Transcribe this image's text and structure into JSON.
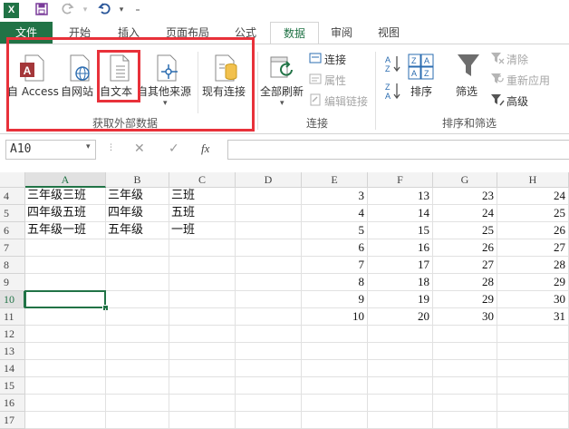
{
  "titlebar": {
    "logo": "X",
    "save_icon": "save-icon",
    "redo_icon": "redo-icon",
    "undo_icon": "undo-icon",
    "customize_icon": "customize-qat-icon"
  },
  "tabs": [
    "文件",
    "开始",
    "插入",
    "页面布局",
    "公式",
    "数据",
    "审阅",
    "视图"
  ],
  "ribbon": {
    "get_external": {
      "buttons": [
        "自 Access",
        "自网站",
        "自文本",
        "自其他来源",
        "现有连接"
      ],
      "group_label": "获取外部数据"
    },
    "connections": {
      "refresh_all": "全部刷新",
      "items": [
        "连接",
        "属性",
        "编辑链接"
      ],
      "group_label": "连接"
    },
    "sort_filter": {
      "sort": "排序",
      "filter": "筛选",
      "items": [
        "清除",
        "重新应用",
        "高级"
      ],
      "group_label": "排序和筛选"
    }
  },
  "formula_bar": {
    "name_box": "A10",
    "cancel": "✕",
    "enter": "✓",
    "fx": "fx",
    "value": ""
  },
  "grid": {
    "columns": [
      "A",
      "B",
      "C",
      "D",
      "E",
      "F",
      "G",
      "H"
    ],
    "active_column": "A",
    "active_row": "10",
    "rows": [
      {
        "num": "4",
        "cells": [
          "三年级三班",
          "三年级",
          "三班",
          "",
          "3",
          "13",
          "23",
          "24"
        ]
      },
      {
        "num": "5",
        "cells": [
          "四年级五班",
          "四年级",
          "五班",
          "",
          "4",
          "14",
          "24",
          "25"
        ]
      },
      {
        "num": "6",
        "cells": [
          "五年级一班",
          "五年级",
          "一班",
          "",
          "5",
          "15",
          "25",
          "26"
        ]
      },
      {
        "num": "7",
        "cells": [
          "",
          "",
          "",
          "",
          "6",
          "16",
          "26",
          "27"
        ]
      },
      {
        "num": "8",
        "cells": [
          "",
          "",
          "",
          "",
          "7",
          "17",
          "27",
          "28"
        ]
      },
      {
        "num": "9",
        "cells": [
          "",
          "",
          "",
          "",
          "8",
          "18",
          "28",
          "29"
        ]
      },
      {
        "num": "10",
        "cells": [
          "",
          "",
          "",
          "",
          "9",
          "19",
          "29",
          "30"
        ]
      },
      {
        "num": "11",
        "cells": [
          "",
          "",
          "",
          "",
          "10",
          "20",
          "30",
          "31"
        ]
      },
      {
        "num": "12",
        "cells": [
          "",
          "",
          "",
          "",
          "",
          "",
          "",
          ""
        ]
      },
      {
        "num": "13",
        "cells": [
          "",
          "",
          "",
          "",
          "",
          "",
          "",
          ""
        ]
      },
      {
        "num": "14",
        "cells": [
          "",
          "",
          "",
          "",
          "",
          "",
          "",
          ""
        ]
      },
      {
        "num": "15",
        "cells": [
          "",
          "",
          "",
          "",
          "",
          "",
          "",
          ""
        ]
      },
      {
        "num": "16",
        "cells": [
          "",
          "",
          "",
          "",
          "",
          "",
          "",
          ""
        ]
      },
      {
        "num": "17",
        "cells": [
          "",
          "",
          "",
          "",
          "",
          "",
          "",
          ""
        ]
      }
    ]
  },
  "colors": {
    "excel_green": "#217346",
    "highlight_red": "#e8313a"
  }
}
